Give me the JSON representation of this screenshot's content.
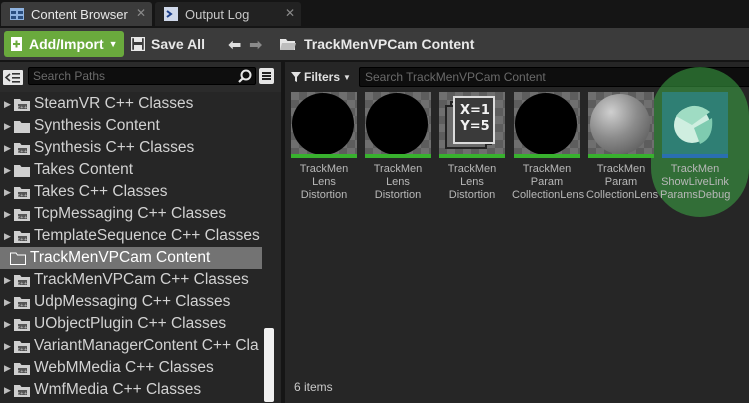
{
  "tabs": [
    {
      "label": "Content Browser",
      "active": true
    },
    {
      "label": "Output Log",
      "active": false
    }
  ],
  "toolbar": {
    "add_import_label": "Add/Import",
    "save_all_label": "Save All",
    "breadcrumb": "TrackMenVPCam Content"
  },
  "left": {
    "search_placeholder": "Search Paths",
    "tree": [
      {
        "label": "SteamVR C++ Classes",
        "type": "cpp",
        "selected": false
      },
      {
        "label": "Synthesis Content",
        "type": "folder",
        "selected": false
      },
      {
        "label": "Synthesis C++ Classes",
        "type": "cpp",
        "selected": false
      },
      {
        "label": "Takes Content",
        "type": "folder",
        "selected": false
      },
      {
        "label": "Takes C++ Classes",
        "type": "cpp",
        "selected": false
      },
      {
        "label": "TcpMessaging C++ Classes",
        "type": "cpp",
        "selected": false
      },
      {
        "label": "TemplateSequence C++ Classes",
        "type": "cpp",
        "selected": false
      },
      {
        "label": "TrackMenVPCam Content",
        "type": "folder",
        "selected": true
      },
      {
        "label": "TrackMenVPCam C++ Classes",
        "type": "cpp",
        "selected": false
      },
      {
        "label": "UdpMessaging C++ Classes",
        "type": "cpp",
        "selected": false
      },
      {
        "label": "UObjectPlugin C++ Classes",
        "type": "cpp",
        "selected": false
      },
      {
        "label": "VariantManagerContent C++ Cla",
        "type": "cpp",
        "selected": false
      },
      {
        "label": "WebMMedia C++ Classes",
        "type": "cpp",
        "selected": false
      },
      {
        "label": "WmfMedia C++ Classes",
        "type": "cpp",
        "selected": false
      }
    ]
  },
  "right": {
    "filters_label": "Filters",
    "search_placeholder": "Search TrackMenVPCam Content",
    "assets": [
      {
        "lines": [
          "TrackMen",
          "Lens",
          "Distortion"
        ],
        "thumb": "black-disc",
        "bar_color": "#38b12e"
      },
      {
        "lines": [
          "TrackMen",
          "Lens",
          "Distortion"
        ],
        "thumb": "black-disc",
        "bar_color": "#38b12e"
      },
      {
        "lines": [
          "TrackMen",
          "Lens",
          "Distortion"
        ],
        "thumb": "xy-param",
        "bar_color": "#38b12e",
        "icon_text": [
          "X=1",
          "Y=5"
        ]
      },
      {
        "lines": [
          "TrackMen",
          "Param",
          "CollectionLens"
        ],
        "thumb": "black-disc",
        "bar_color": "#38b12e"
      },
      {
        "lines": [
          "TrackMen",
          "Param",
          "CollectionLens"
        ],
        "thumb": "grey-sphere",
        "bar_color": "#38b12e"
      },
      {
        "lines": [
          "TrackMen",
          "ShowLiveLink",
          "ParamsDebug"
        ],
        "thumb": "blueprint",
        "bar_color": "#2a6fb0"
      }
    ],
    "item_count": "6 items"
  },
  "colors": {
    "add_button": "#6aaa3d",
    "selected_row": "#737373",
    "highlight": "#3caa46"
  }
}
